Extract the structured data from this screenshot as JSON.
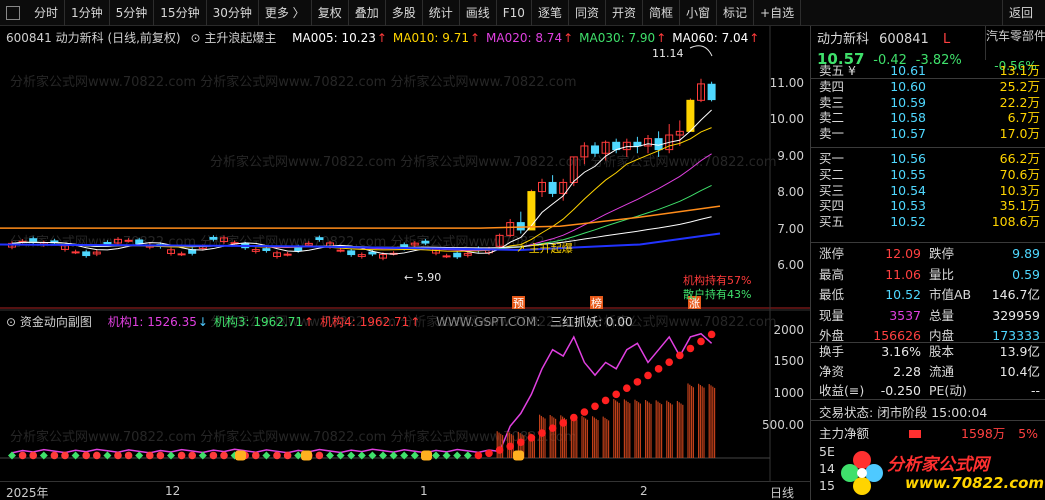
{
  "toolbar": {
    "items": [
      "分时",
      "1分钟",
      "5分钟",
      "15分钟",
      "30分钟",
      "更多 〉",
      "复权",
      "叠加",
      "多股",
      "统计",
      "画线",
      "F10",
      "逐笔",
      "同资",
      "开资",
      "简框",
      "小窗",
      "标记",
      "+自选"
    ],
    "back": "返回"
  },
  "chart": {
    "title": "600841 动力新科 (日线,前复权)",
    "indicator_name": "主升浪起爆主",
    "ma": [
      {
        "label": "MA005: 10.23",
        "color": "#ffffff"
      },
      {
        "label": "MA010: 9.71",
        "color": "#ffd400"
      },
      {
        "label": "MA020: 8.74",
        "color": "#e040e0"
      },
      {
        "label": "MA030: 7.90",
        "color": "#3fe06b"
      },
      {
        "label": "MA060: 7.04",
        "color": "#ffffff"
      }
    ],
    "y_labels": [
      "11.00",
      "10.00",
      "9.00",
      "8.00",
      "7.00",
      "6.00"
    ],
    "y_values": [
      11,
      10,
      9,
      8,
      7,
      6
    ],
    "high_label": "11.14",
    "low_label": "5.90",
    "signal_label": "主升起爆",
    "holding_inst": "机构持有57%",
    "holding_retail": "散户持有43%",
    "markers": [
      "预",
      "榜",
      "涨"
    ],
    "watermark": "分析家公式网www.70822.com"
  },
  "sub": {
    "name": "资金动向副图",
    "items": [
      {
        "label": "机构1: 1526.35",
        "color": "#e040e0",
        "arrow": "↓",
        "arrow_color": "#4ec9ff"
      },
      {
        "label": "机构3: 1962.71",
        "color": "#3fe06b",
        "arrow": "↑",
        "arrow_color": "#ff3b3b"
      },
      {
        "label": "机构4: 1962.71",
        "color": "#ff3b3b",
        "arrow": "↑",
        "arrow_color": "#ff3b3b"
      }
    ],
    "site": "WWW.GSPT.COM:",
    "extra": "三红抓妖: 0.00",
    "y_labels": [
      "2000",
      "1500",
      "1000",
      "500.00"
    ],
    "y_values": [
      2000,
      1500,
      1000,
      500
    ]
  },
  "x_axis": {
    "labels": [
      "2025年",
      "12",
      "1",
      "2"
    ],
    "period": "日线"
  },
  "panel": {
    "name": "动力新科",
    "code": "600841",
    "flag": "L",
    "price": "10.57",
    "change": "-0.42",
    "change_pct": "-3.82%",
    "sector": "汽车零部件",
    "sector_chg": "-0.56%",
    "asks": [
      {
        "label": "卖五 ¥",
        "price": "10.61",
        "vol": "13.1万"
      },
      {
        "label": "卖四",
        "price": "10.60",
        "vol": "25.2万"
      },
      {
        "label": "卖三",
        "price": "10.59",
        "vol": "22.2万"
      },
      {
        "label": "卖二",
        "price": "10.58",
        "vol": "6.7万"
      },
      {
        "label": "卖一",
        "price": "10.57",
        "vol": "17.0万"
      }
    ],
    "bids": [
      {
        "label": "买一",
        "price": "10.56",
        "vol": "66.2万"
      },
      {
        "label": "买二",
        "price": "10.55",
        "vol": "70.6万"
      },
      {
        "label": "买三",
        "price": "10.54",
        "vol": "10.3万"
      },
      {
        "label": "买四",
        "price": "10.53",
        "vol": "35.1万"
      },
      {
        "label": "买五",
        "price": "10.52",
        "vol": "108.6万"
      }
    ],
    "stats": [
      {
        "k1": "涨停",
        "v1": "12.09",
        "c1": "red",
        "k2": "跌停",
        "v2": "9.89",
        "c2": "cyan"
      },
      {
        "k1": "最高",
        "v1": "11.06",
        "c1": "red",
        "k2": "量比",
        "v2": "0.59",
        "c2": "cyan"
      },
      {
        "k1": "最低",
        "v1": "10.52",
        "c1": "cyan",
        "k2": "市值AB",
        "v2": "146.7亿",
        "c2": "white"
      },
      {
        "k1": "现量",
        "v1": "3537",
        "c1": "mag",
        "k2": "总量",
        "v2": "329959",
        "c2": "white"
      },
      {
        "k1": "外盘",
        "v1": "156626",
        "c1": "red",
        "k2": "内盘",
        "v2": "173333",
        "c2": "cyan"
      }
    ],
    "stats2": [
      {
        "k1": "换手",
        "v1": "3.16%",
        "c1": "white",
        "k2": "股本",
        "v2": "13.9亿",
        "c2": "white"
      },
      {
        "k1": "净资",
        "v1": "2.28",
        "c1": "white",
        "k2": "流通",
        "v2": "10.4亿",
        "c2": "white"
      },
      {
        "k1": "收益(≡)",
        "v1": "-0.250",
        "c1": "white",
        "k2": "PE(动)",
        "v2": "--",
        "c2": "white"
      }
    ],
    "status_label": "交易状态:",
    "status_value": "闭市阶段 15:00:04",
    "flow_label": "主力净额",
    "flow_value": "1598万",
    "flow_pct": "5%",
    "extra_rows": [
      "5E",
      "14",
      "15"
    ],
    "logo_text": "分析家公式网",
    "logo_url": "www.70822.com"
  }
}
